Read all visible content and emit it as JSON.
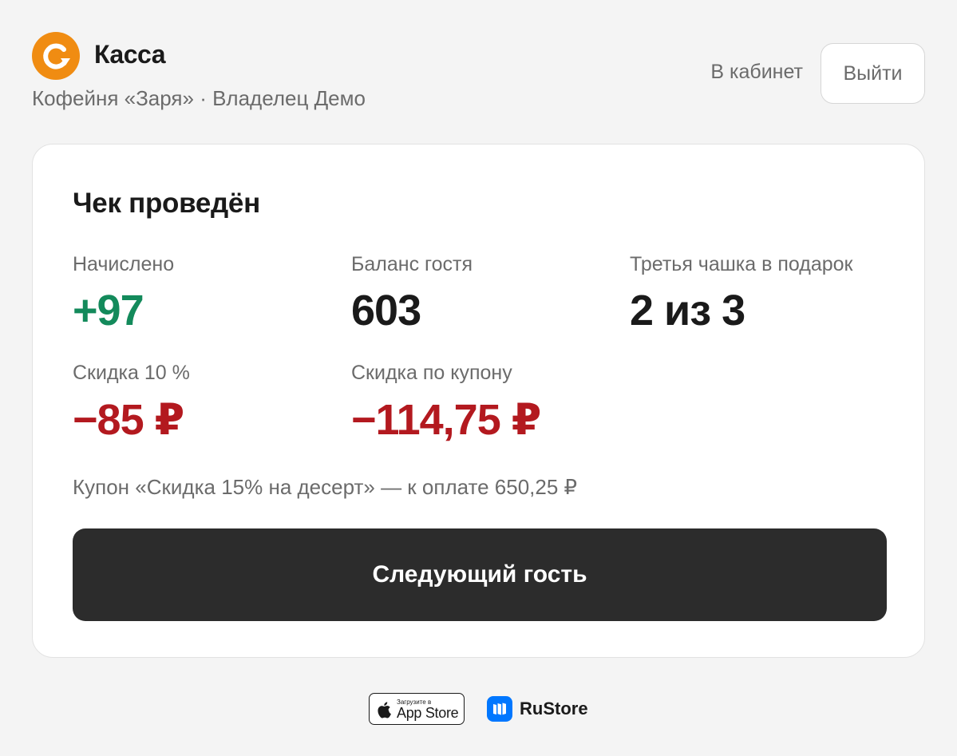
{
  "header": {
    "title": "Касса",
    "subtitle": "Кофейня «Заря» · Владелец Демо",
    "cabinet_link": "В кабинет",
    "logout_label": "Выйти"
  },
  "receipt": {
    "title": "Чек проведён",
    "stats": {
      "accrued": {
        "label": "Начислено",
        "value": "+97"
      },
      "balance": {
        "label": "Баланс гостя",
        "value": "603"
      },
      "promo": {
        "label": "Третья чашка в подарок",
        "value": "2 из 3"
      },
      "discount": {
        "label": "Скидка 10 %",
        "value": "−85 ₽"
      },
      "coupon": {
        "label": "Скидка по купону",
        "value": "−114,75 ₽"
      }
    },
    "note": "Купон «Скидка 15% на десерт» — к оплате 650,25 ₽",
    "next_button": "Следующий гость"
  },
  "stores": {
    "appstore_small": "Загрузите в",
    "appstore_big": "App Store",
    "rustore_label": "RuStore"
  },
  "colors": {
    "accent_orange": "#f08c12",
    "positive_green": "#138a5b",
    "negative_red": "#b3191f",
    "button_dark": "#2c2c2c",
    "rustore_blue": "#0077ff"
  },
  "icons": {
    "logo": "refresh-arrow-logo",
    "apple": "apple-icon",
    "rustore": "rustore-icon"
  }
}
